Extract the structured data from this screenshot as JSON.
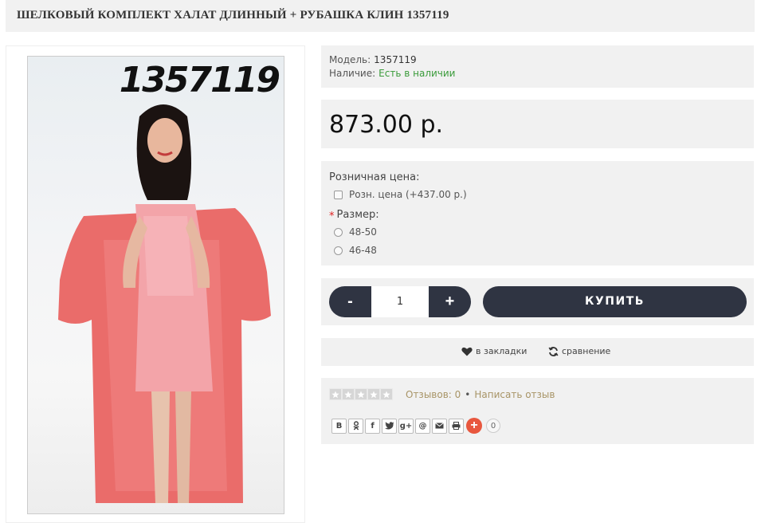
{
  "product": {
    "title": "ШЕЛКОВЫЙ КОМПЛЕКТ ХАЛАТ ДЛИННЫЙ + РУБАШКА КЛИН 1357119",
    "image_code": "1357119"
  },
  "info": {
    "model_label": "Модель:",
    "model_value": "1357119",
    "stock_label": "Наличие:",
    "stock_value": "Есть в наличии"
  },
  "price": "873.00 р.",
  "options": {
    "retail_heading": "Розничная цена:",
    "retail_option": "Розн. цена (+437.00 р.)",
    "size_heading": "Размер:",
    "required_mark": "*",
    "sizes": [
      "48-50",
      "46-48"
    ]
  },
  "cart": {
    "minus": "-",
    "quantity": "1",
    "plus": "+",
    "buy_label": "КУПИТЬ"
  },
  "links": {
    "wishlist": "в закладки",
    "compare": "сравнение"
  },
  "reviews": {
    "rating": 0,
    "count_text": "Отзывов: 0",
    "separator": "•",
    "write_text": "Написать отзыв"
  },
  "share": {
    "buttons": [
      "В",
      "ok",
      "f",
      "twitter",
      "g+",
      "@",
      "mail",
      "print"
    ],
    "count": "0"
  },
  "colors": {
    "dark_button": "#2f3442",
    "in_stock": "#3a9b3a",
    "review_link": "#a89466",
    "share_plus": "#e8573e",
    "panel_bg": "#f1f1f1"
  }
}
